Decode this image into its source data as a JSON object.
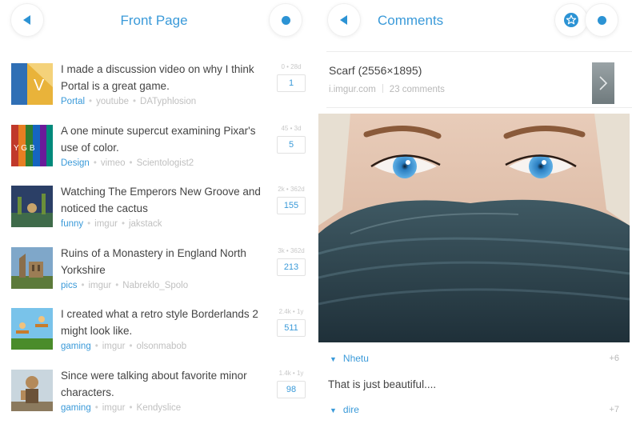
{
  "left": {
    "title": "Front Page",
    "items": [
      {
        "title": "I made a discussion video on why I think Portal is a great game.",
        "category": "Portal",
        "source": "youtube",
        "user": "DATyphlosion",
        "stat": "0 • 28d",
        "count": "1"
      },
      {
        "title": "A one minute supercut examining  Pixar's use of color.",
        "category": "Design",
        "source": "vimeo",
        "user": "Scientologist2",
        "stat": "45 • 3d",
        "count": "5"
      },
      {
        "title": "Watching The Emperors New Groove and noticed the cactus",
        "category": "funny",
        "source": "imgur",
        "user": "jakstack",
        "stat": "2k • 362d",
        "count": "155"
      },
      {
        "title": "Ruins of a Monastery in England North Yorkshire",
        "category": "pics",
        "source": "imgur",
        "user": "Nabreklo_Spolo",
        "stat": "3k • 362d",
        "count": "213"
      },
      {
        "title": "I created what a retro style Borderlands 2 might look like.",
        "category": "gaming",
        "source": "imgur",
        "user": "olsonmabob",
        "stat": "2.4k • 1y",
        "count": "511"
      },
      {
        "title": "Since were talking about favorite minor characters.",
        "category": "gaming",
        "source": "imgur",
        "user": "Kendyslice",
        "stat": "1.4k • 1y",
        "count": "98"
      }
    ]
  },
  "right": {
    "title": "Comments",
    "post": {
      "title": "Scarf (2556×1895)",
      "domain": "i.imgur.com",
      "comments": "23 comments"
    },
    "comments": [
      {
        "user": "Nhetu",
        "score": "+6",
        "text": "That is just beautiful...."
      },
      {
        "user": "dire",
        "score": "+7"
      }
    ]
  },
  "icons": {
    "back": "back-arrow-icon",
    "menu": "dot-menu-icon",
    "favorite": "star-icon",
    "next": "chevron-right-icon",
    "collapse": "triangle-down-icon"
  },
  "colors": {
    "accent": "#2c93d4",
    "link": "#3a9ad9",
    "muted": "#c0c0c0"
  }
}
